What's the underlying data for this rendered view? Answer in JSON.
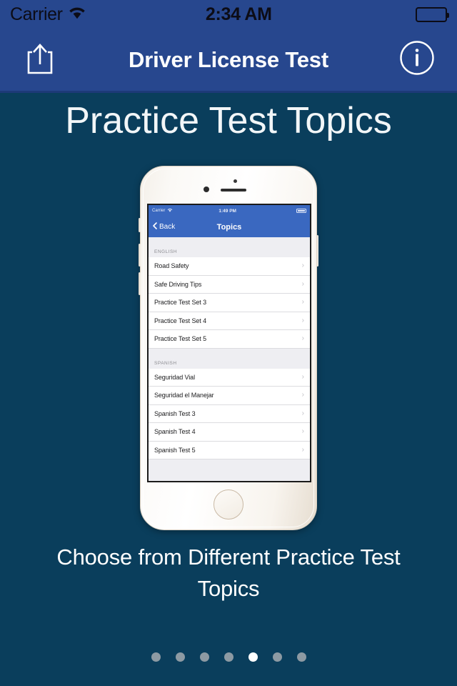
{
  "status_bar": {
    "carrier": "Carrier",
    "time": "2:34 AM",
    "wifi_icon": "wifi-icon",
    "battery_icon": "battery-full-icon"
  },
  "header": {
    "title": "Driver License Test",
    "share_icon": "share-icon",
    "info_icon": "info-circle-icon"
  },
  "page": {
    "title": "Practice Test Topics",
    "caption": "Choose from Different Practice Test Topics"
  },
  "phone_screen": {
    "status_bar": {
      "carrier": "Carrier",
      "time": "1:49 PM",
      "wifi_icon": "wifi-icon",
      "battery_icon": "battery-full-icon"
    },
    "nav": {
      "back_label": "Back",
      "back_icon": "chevron-left-icon",
      "title": "Topics"
    },
    "sections": [
      {
        "header": "ENGLISH",
        "rows": [
          {
            "label": "Road Safety",
            "accessory": "chevron-right-icon"
          },
          {
            "label": "Safe Driving Tips",
            "accessory": "chevron-right-icon"
          },
          {
            "label": "Practice Test Set 3",
            "accessory": "chevron-right-icon"
          },
          {
            "label": "Practice Test Set 4",
            "accessory": "chevron-right-icon"
          },
          {
            "label": "Practice Test Set 5",
            "accessory": "chevron-right-icon"
          }
        ]
      },
      {
        "header": "SPANISH",
        "rows": [
          {
            "label": "Seguridad Vial",
            "accessory": "chevron-right-icon"
          },
          {
            "label": "Seguridad el Manejar",
            "accessory": "chevron-right-icon"
          },
          {
            "label": "Spanish Test 3",
            "accessory": "chevron-right-icon"
          },
          {
            "label": "Spanish Test 4",
            "accessory": "chevron-right-icon"
          },
          {
            "label": "Spanish Test 5",
            "accessory": "chevron-right-icon"
          }
        ]
      }
    ]
  },
  "pagination": {
    "total": 7,
    "active_index": 4
  },
  "colors": {
    "header_blue": "#27478e",
    "background": "#0a3e5c",
    "phone_nav_blue": "#3a68c0",
    "dot_inactive": "#8d9aa3",
    "dot_active": "#ffffff"
  }
}
